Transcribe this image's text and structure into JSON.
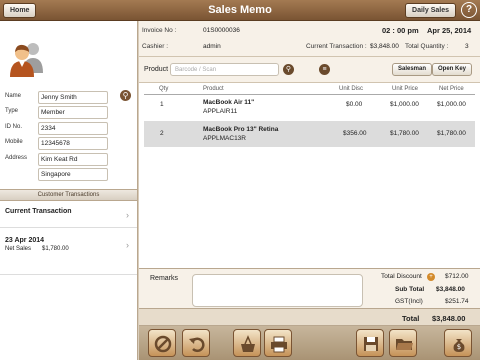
{
  "titlebar": {
    "title": "Sales Memo",
    "home_label": "Home",
    "daily_sales_label": "Daily Sales",
    "help_symbol": "?"
  },
  "customer": {
    "fields": [
      {
        "label": "Name",
        "value": "Jenny Smith"
      },
      {
        "label": "Type",
        "value": "Member"
      },
      {
        "label": "ID No.",
        "value": "2334"
      },
      {
        "label": "Mobile",
        "value": "12345678"
      },
      {
        "label": "Address",
        "value": "Kim Keat Rd"
      },
      {
        "label": "",
        "value": "Singapore"
      }
    ]
  },
  "transactions": {
    "header": "Customer Transactions",
    "current_label": "Current Transaction",
    "items": [
      {
        "date": "23 Apr 2014",
        "net_label": "Net Sales",
        "net_value": "$1,780.00"
      }
    ]
  },
  "info": {
    "invoice_label": "Invoice No :",
    "invoice_value": "01S0000036",
    "time": "02 : 00 pm",
    "date": "Apr 25, 2014",
    "cashier_label": "Cashier :",
    "cashier_value": "admin",
    "current_txn_label": "Current Transaction :",
    "current_txn_value": "$3,848.00",
    "total_qty_label": "Total Quantity :",
    "total_qty_value": "3"
  },
  "product_search": {
    "label": "Product",
    "placeholder": "Barcode / Scan",
    "salesman_label": "Salesman",
    "open_key_label": "Open Key"
  },
  "table": {
    "headers": {
      "qty": "Qty",
      "product": "Product",
      "unit_disc": "Unit Disc",
      "unit_price": "Unit Price",
      "net_price": "Net Price"
    },
    "rows": [
      {
        "qty": "1",
        "name": "MacBook Air 11\"",
        "code": "APPLAIR11",
        "unit_disc": "$0.00",
        "unit_price": "$1,000.00",
        "net_price": "$1,000.00"
      },
      {
        "qty": "2",
        "name": "MacBook Pro 13\" Retina",
        "code": "APPLMAC13R",
        "unit_disc": "$356.00",
        "unit_price": "$1,780.00",
        "net_price": "$1,780.00"
      }
    ]
  },
  "summary": {
    "remarks_label": "Remarks",
    "total_discount_label": "Total Discount",
    "total_discount_value": "$712.00",
    "subtotal_label": "Sub Total",
    "subtotal_value": "$3,848.00",
    "gst_label": "GST(Incl)",
    "gst_value": "$251.74",
    "total_label": "Total",
    "total_value": "$3,848.00"
  },
  "toolbar": {
    "icons": [
      "cancel-icon",
      "undo-icon",
      "clear-cart-icon",
      "print-icon",
      "save-icon",
      "folder-icon",
      "payment-icon"
    ]
  },
  "colors": {
    "brand": "#7a5433",
    "selected_row": "#dcdcdc",
    "panel": "#f7f1e8"
  }
}
